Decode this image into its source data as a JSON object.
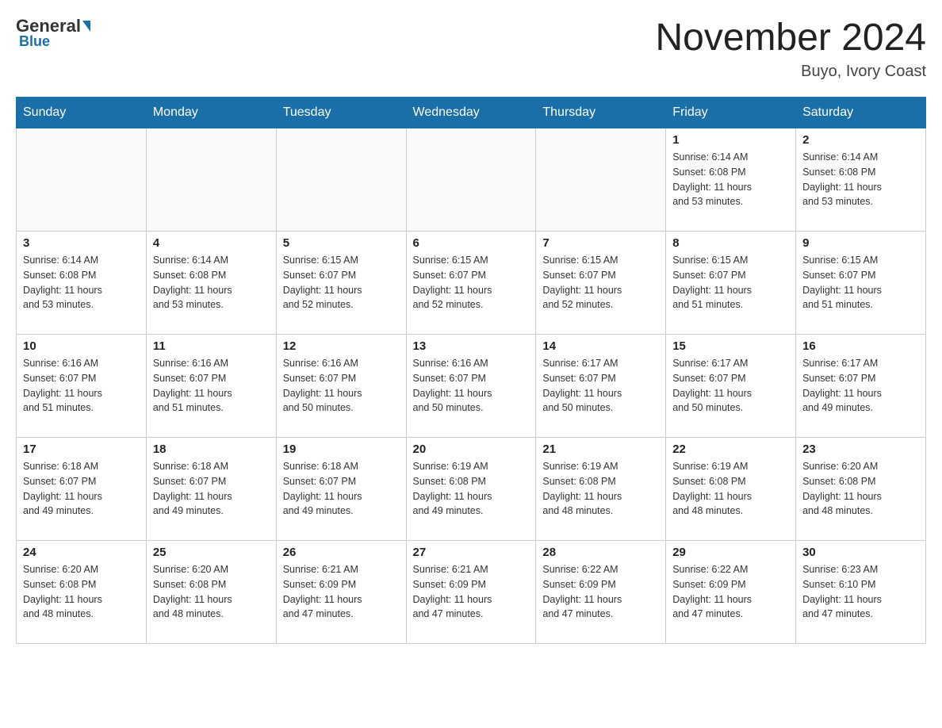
{
  "logo": {
    "general": "General",
    "blue": "Blue"
  },
  "header": {
    "month": "November 2024",
    "location": "Buyo, Ivory Coast"
  },
  "weekdays": [
    "Sunday",
    "Monday",
    "Tuesday",
    "Wednesday",
    "Thursday",
    "Friday",
    "Saturday"
  ],
  "weeks": [
    [
      {
        "day": "",
        "info": ""
      },
      {
        "day": "",
        "info": ""
      },
      {
        "day": "",
        "info": ""
      },
      {
        "day": "",
        "info": ""
      },
      {
        "day": "",
        "info": ""
      },
      {
        "day": "1",
        "info": "Sunrise: 6:14 AM\nSunset: 6:08 PM\nDaylight: 11 hours\nand 53 minutes."
      },
      {
        "day": "2",
        "info": "Sunrise: 6:14 AM\nSunset: 6:08 PM\nDaylight: 11 hours\nand 53 minutes."
      }
    ],
    [
      {
        "day": "3",
        "info": "Sunrise: 6:14 AM\nSunset: 6:08 PM\nDaylight: 11 hours\nand 53 minutes."
      },
      {
        "day": "4",
        "info": "Sunrise: 6:14 AM\nSunset: 6:08 PM\nDaylight: 11 hours\nand 53 minutes."
      },
      {
        "day": "5",
        "info": "Sunrise: 6:15 AM\nSunset: 6:07 PM\nDaylight: 11 hours\nand 52 minutes."
      },
      {
        "day": "6",
        "info": "Sunrise: 6:15 AM\nSunset: 6:07 PM\nDaylight: 11 hours\nand 52 minutes."
      },
      {
        "day": "7",
        "info": "Sunrise: 6:15 AM\nSunset: 6:07 PM\nDaylight: 11 hours\nand 52 minutes."
      },
      {
        "day": "8",
        "info": "Sunrise: 6:15 AM\nSunset: 6:07 PM\nDaylight: 11 hours\nand 51 minutes."
      },
      {
        "day": "9",
        "info": "Sunrise: 6:15 AM\nSunset: 6:07 PM\nDaylight: 11 hours\nand 51 minutes."
      }
    ],
    [
      {
        "day": "10",
        "info": "Sunrise: 6:16 AM\nSunset: 6:07 PM\nDaylight: 11 hours\nand 51 minutes."
      },
      {
        "day": "11",
        "info": "Sunrise: 6:16 AM\nSunset: 6:07 PM\nDaylight: 11 hours\nand 51 minutes."
      },
      {
        "day": "12",
        "info": "Sunrise: 6:16 AM\nSunset: 6:07 PM\nDaylight: 11 hours\nand 50 minutes."
      },
      {
        "day": "13",
        "info": "Sunrise: 6:16 AM\nSunset: 6:07 PM\nDaylight: 11 hours\nand 50 minutes."
      },
      {
        "day": "14",
        "info": "Sunrise: 6:17 AM\nSunset: 6:07 PM\nDaylight: 11 hours\nand 50 minutes."
      },
      {
        "day": "15",
        "info": "Sunrise: 6:17 AM\nSunset: 6:07 PM\nDaylight: 11 hours\nand 50 minutes."
      },
      {
        "day": "16",
        "info": "Sunrise: 6:17 AM\nSunset: 6:07 PM\nDaylight: 11 hours\nand 49 minutes."
      }
    ],
    [
      {
        "day": "17",
        "info": "Sunrise: 6:18 AM\nSunset: 6:07 PM\nDaylight: 11 hours\nand 49 minutes."
      },
      {
        "day": "18",
        "info": "Sunrise: 6:18 AM\nSunset: 6:07 PM\nDaylight: 11 hours\nand 49 minutes."
      },
      {
        "day": "19",
        "info": "Sunrise: 6:18 AM\nSunset: 6:07 PM\nDaylight: 11 hours\nand 49 minutes."
      },
      {
        "day": "20",
        "info": "Sunrise: 6:19 AM\nSunset: 6:08 PM\nDaylight: 11 hours\nand 49 minutes."
      },
      {
        "day": "21",
        "info": "Sunrise: 6:19 AM\nSunset: 6:08 PM\nDaylight: 11 hours\nand 48 minutes."
      },
      {
        "day": "22",
        "info": "Sunrise: 6:19 AM\nSunset: 6:08 PM\nDaylight: 11 hours\nand 48 minutes."
      },
      {
        "day": "23",
        "info": "Sunrise: 6:20 AM\nSunset: 6:08 PM\nDaylight: 11 hours\nand 48 minutes."
      }
    ],
    [
      {
        "day": "24",
        "info": "Sunrise: 6:20 AM\nSunset: 6:08 PM\nDaylight: 11 hours\nand 48 minutes."
      },
      {
        "day": "25",
        "info": "Sunrise: 6:20 AM\nSunset: 6:08 PM\nDaylight: 11 hours\nand 48 minutes."
      },
      {
        "day": "26",
        "info": "Sunrise: 6:21 AM\nSunset: 6:09 PM\nDaylight: 11 hours\nand 47 minutes."
      },
      {
        "day": "27",
        "info": "Sunrise: 6:21 AM\nSunset: 6:09 PM\nDaylight: 11 hours\nand 47 minutes."
      },
      {
        "day": "28",
        "info": "Sunrise: 6:22 AM\nSunset: 6:09 PM\nDaylight: 11 hours\nand 47 minutes."
      },
      {
        "day": "29",
        "info": "Sunrise: 6:22 AM\nSunset: 6:09 PM\nDaylight: 11 hours\nand 47 minutes."
      },
      {
        "day": "30",
        "info": "Sunrise: 6:23 AM\nSunset: 6:10 PM\nDaylight: 11 hours\nand 47 minutes."
      }
    ]
  ]
}
